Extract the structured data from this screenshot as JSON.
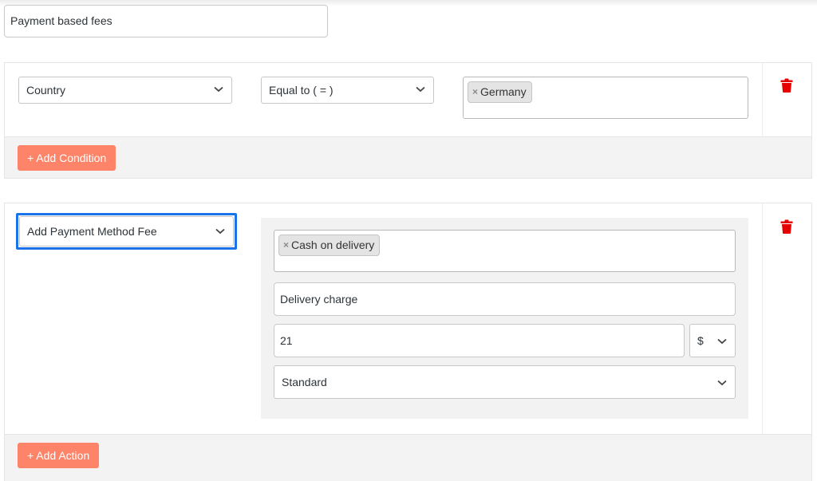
{
  "rule_title": {
    "value": "Payment based fees"
  },
  "conditions": {
    "field_select": "Country",
    "operator_select": "Equal to ( = )",
    "values": [
      {
        "label": "Germany",
        "remove_icon": "×"
      }
    ],
    "delete_icon": "trash-icon",
    "add_button": "+ Add Condition"
  },
  "actions": {
    "type_select": "Add Payment Method Fee",
    "payment_methods": [
      {
        "label": "Cash on delivery",
        "remove_icon": "×"
      }
    ],
    "fee_label": "Delivery charge",
    "amount": "21",
    "currency_select": "$",
    "tax_class_select": "Standard",
    "delete_icon": "trash-icon",
    "add_button": "+ Add Action"
  },
  "colors": {
    "accent_button": "#fd8468",
    "delete_icon": "#e60000",
    "focus_ring": "#1a73e8"
  }
}
